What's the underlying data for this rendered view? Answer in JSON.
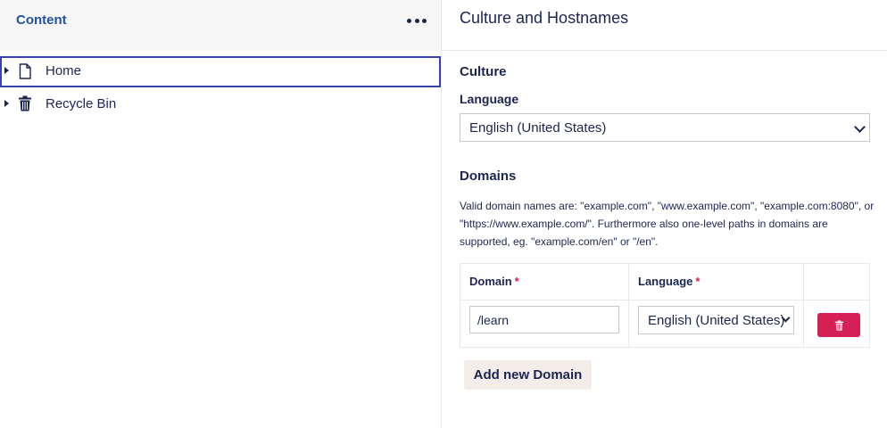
{
  "tree": {
    "title": "Content",
    "menu_icon": "more-dots-icon",
    "items": [
      {
        "label": "Home",
        "icon": "document-icon",
        "selected": true
      },
      {
        "label": "Recycle Bin",
        "icon": "trash-icon",
        "selected": false
      }
    ]
  },
  "main": {
    "title": "Culture and Hostnames",
    "culture": {
      "title": "Culture",
      "language_label": "Language",
      "language_value": "English (United States)"
    },
    "domains": {
      "title": "Domains",
      "help": "Valid domain names are: \"example.com\", \"www.example.com\", \"example.com:8080\", or \"https://www.example.com/\". Furthermore also one-level paths in domains are supported, eg. \"example.com/en\" or \"/en\".",
      "columns": {
        "domain": "Domain",
        "language": "Language",
        "required_mark": "*"
      },
      "rows": [
        {
          "domain": "/learn",
          "language": "English (United States)"
        }
      ],
      "add_label": "Add new Domain"
    }
  },
  "colors": {
    "accent": "#2152a3",
    "text": "#1b264f",
    "danger": "#d42054",
    "selection_border": "#3544b1",
    "secondary_button": "#f3ece8"
  }
}
